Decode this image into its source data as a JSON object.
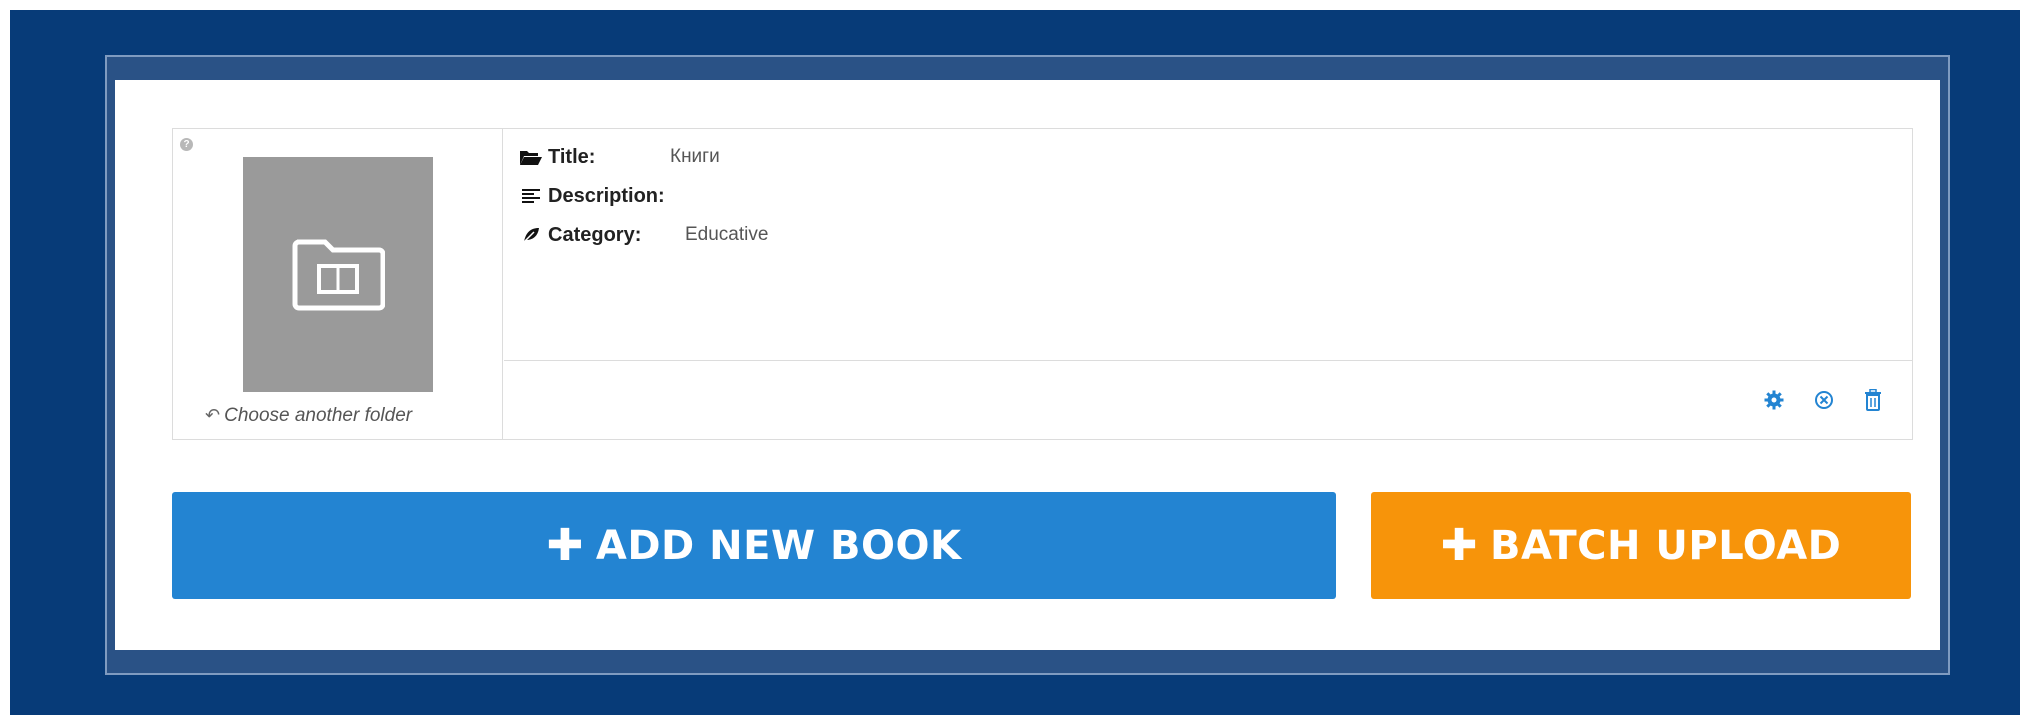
{
  "folder": {
    "help_glyph": "?",
    "choose_label": "Choose another folder",
    "fields": {
      "title_label": "Title:",
      "title_value": "Книги",
      "description_label": "Description:",
      "description_value": "",
      "category_label": "Category:",
      "category_value": "Educative"
    },
    "actions": [
      "gear-icon",
      "close-circle-icon",
      "trash-icon"
    ]
  },
  "buttons": {
    "add_plus": "✚",
    "add_label": "ADD NEW BOOK",
    "batch_plus": "✚",
    "batch_label": "BATCH UPLOAD"
  },
  "colors": {
    "background": "#073b78",
    "add_button": "#2384d2",
    "batch_button": "#f7940a",
    "icon_blue": "#2384d2"
  }
}
